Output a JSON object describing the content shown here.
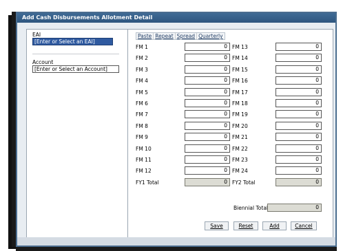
{
  "dialog": {
    "title": "Add Cash Disbursements Allotment Detail"
  },
  "left": {
    "eai_label": "EAI",
    "eai_value": "[Enter or Select an EAI]",
    "account_label": "Account",
    "account_value": "[Enter or Select an Account]"
  },
  "toolbar": [
    "Paste",
    "Repeat",
    "Spread",
    "Quarterly"
  ],
  "months_left": [
    {
      "label": "FM 1",
      "value": "0"
    },
    {
      "label": "FM 2",
      "value": "0"
    },
    {
      "label": "FM 3",
      "value": "0"
    },
    {
      "label": "FM 4",
      "value": "0"
    },
    {
      "label": "FM 5",
      "value": "0"
    },
    {
      "label": "FM 6",
      "value": "0"
    },
    {
      "label": "FM 7",
      "value": "0"
    },
    {
      "label": "FM 8",
      "value": "0"
    },
    {
      "label": "FM 9",
      "value": "0"
    },
    {
      "label": "FM 10",
      "value": "0"
    },
    {
      "label": "FM 11",
      "value": "0"
    },
    {
      "label": "FM 12",
      "value": "0"
    }
  ],
  "months_right": [
    {
      "label": "FM 13",
      "value": "0"
    },
    {
      "label": "FM 14",
      "value": "0"
    },
    {
      "label": "FM 15",
      "value": "0"
    },
    {
      "label": "FM 16",
      "value": "0"
    },
    {
      "label": "FM 17",
      "value": "0"
    },
    {
      "label": "FM 18",
      "value": "0"
    },
    {
      "label": "FM 19",
      "value": "0"
    },
    {
      "label": "FM 20",
      "value": "0"
    },
    {
      "label": "FM 21",
      "value": "0"
    },
    {
      "label": "FM 22",
      "value": "0"
    },
    {
      "label": "FM 23",
      "value": "0"
    },
    {
      "label": "FM 24",
      "value": "0"
    }
  ],
  "totals": {
    "fy1_label": "FY1 Total",
    "fy1_value": "0",
    "fy2_label": "FY2 Total",
    "fy2_value": "0",
    "biennial_label": "Biennial Total",
    "biennial_value": "0"
  },
  "buttons": {
    "save": "Save",
    "reset": "Reset",
    "add": "Add",
    "cancel": "Cancel"
  },
  "colors": {
    "titlebar": "#2e567f",
    "selected_input": "#2f5aa0",
    "readonly_input": "#dcdcd4"
  }
}
